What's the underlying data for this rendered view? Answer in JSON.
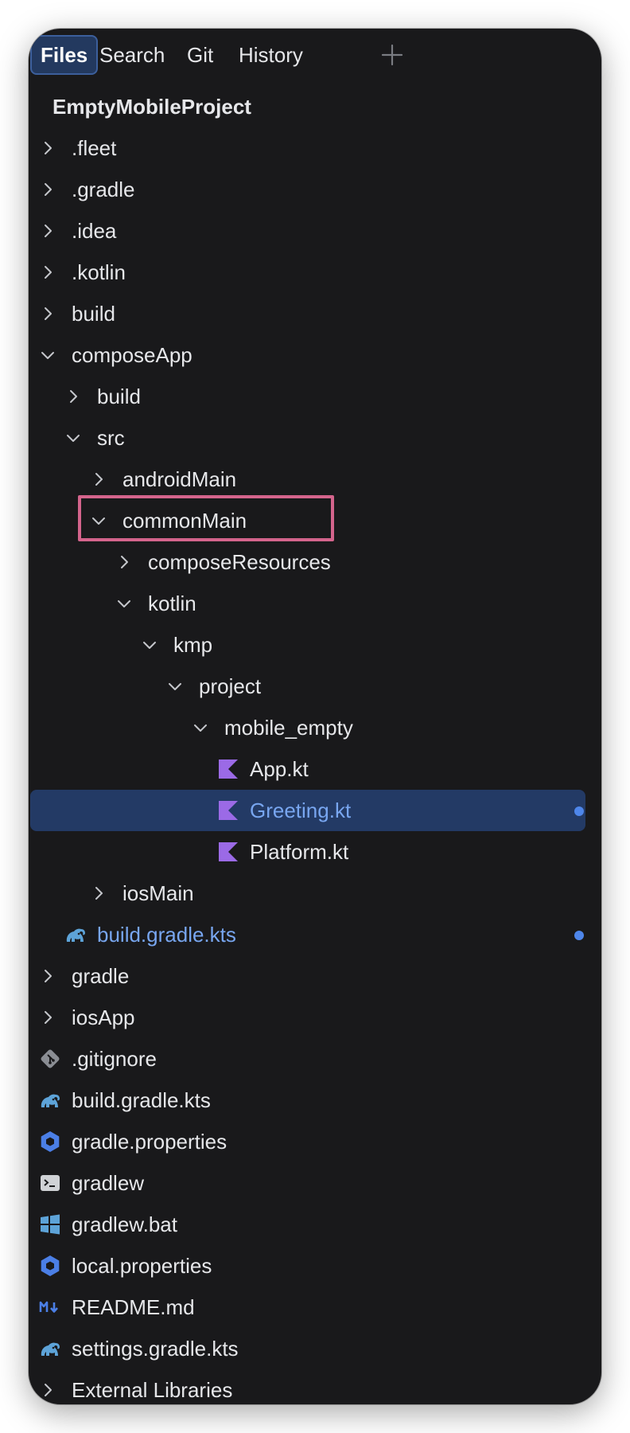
{
  "tabs": [
    {
      "label": "Files",
      "active": true
    },
    {
      "label": "Search",
      "active": false
    },
    {
      "label": "Git",
      "active": false
    },
    {
      "label": "History",
      "active": false
    }
  ],
  "add_tab_icon": "plus-icon",
  "tree": {
    "project": "EmptyMobileProject",
    "items": [
      {
        "label": ".fleet",
        "type": "folder",
        "state": "collapsed"
      },
      {
        "label": ".gradle",
        "type": "folder",
        "state": "collapsed"
      },
      {
        "label": ".idea",
        "type": "folder",
        "state": "collapsed"
      },
      {
        "label": ".kotlin",
        "type": "folder",
        "state": "collapsed"
      },
      {
        "label": "build",
        "type": "folder",
        "state": "collapsed"
      },
      {
        "label": "composeApp",
        "type": "folder",
        "state": "expanded"
      },
      {
        "label": "build",
        "type": "folder",
        "state": "collapsed"
      },
      {
        "label": "src",
        "type": "folder",
        "state": "expanded"
      },
      {
        "label": "androidMain",
        "type": "folder",
        "state": "collapsed"
      },
      {
        "label": "commonMain",
        "type": "folder",
        "state": "expanded",
        "highlighted": true
      },
      {
        "label": "composeResources",
        "type": "folder",
        "state": "collapsed"
      },
      {
        "label": "kotlin",
        "type": "folder",
        "state": "expanded"
      },
      {
        "label": "kmp",
        "type": "folder",
        "state": "expanded"
      },
      {
        "label": "project",
        "type": "folder",
        "state": "expanded"
      },
      {
        "label": "mobile_empty",
        "type": "folder",
        "state": "expanded"
      },
      {
        "label": "App.kt",
        "type": "file",
        "icon": "kotlin-icon"
      },
      {
        "label": "Greeting.kt",
        "type": "file",
        "icon": "kotlin-icon",
        "selected": true,
        "modified": true
      },
      {
        "label": "Platform.kt",
        "type": "file",
        "icon": "kotlin-icon"
      },
      {
        "label": "iosMain",
        "type": "folder",
        "state": "collapsed"
      },
      {
        "label": "build.gradle.kts",
        "type": "file",
        "icon": "gradle-elephant-icon",
        "modified": true
      },
      {
        "label": "gradle",
        "type": "folder",
        "state": "collapsed"
      },
      {
        "label": "iosApp",
        "type": "folder",
        "state": "collapsed"
      },
      {
        "label": ".gitignore",
        "type": "file",
        "icon": "git-icon"
      },
      {
        "label": "build.gradle.kts",
        "type": "file",
        "icon": "gradle-elephant-icon"
      },
      {
        "label": "gradle.properties",
        "type": "file",
        "icon": "properties-hexagon-icon"
      },
      {
        "label": "gradlew",
        "type": "file",
        "icon": "terminal-icon"
      },
      {
        "label": "gradlew.bat",
        "type": "file",
        "icon": "windows-icon"
      },
      {
        "label": "local.properties",
        "type": "file",
        "icon": "properties-hexagon-icon"
      },
      {
        "label": "README.md",
        "type": "file",
        "icon": "markdown-icon"
      },
      {
        "label": "settings.gradle.kts",
        "type": "file",
        "icon": "gradle-elephant-icon"
      },
      {
        "label": "External Libraries",
        "type": "folder",
        "state": "collapsed"
      }
    ]
  },
  "colors": {
    "background": "#19191b",
    "selection": "#233a65",
    "modified_text": "#78a6f0",
    "modified_dot": "#4e86ea",
    "highlight_box": "#d4648c",
    "kotlin": "#9b6ae6",
    "gradle": "#5da3d8",
    "properties": "#4b7fe6"
  }
}
